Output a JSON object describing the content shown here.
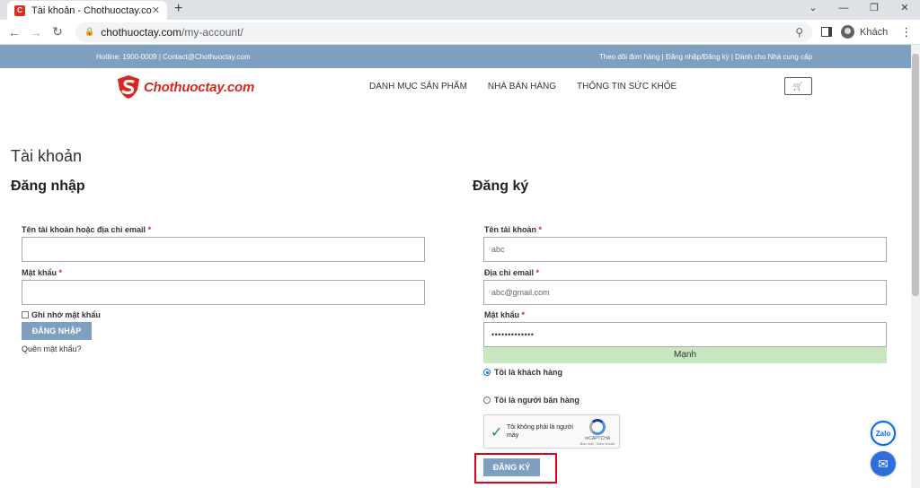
{
  "browser": {
    "tab_title": "Tài khoản - Chothuoctay.com",
    "tab_favicon": "C",
    "tab_close": "✕",
    "new_tab": "+",
    "url_host": "chothuoctay.com",
    "url_path": "/my-account/",
    "profile_label": "Khách",
    "win_controls": [
      "⌄",
      "—",
      "❐",
      "✕"
    ]
  },
  "topbar": {
    "left": "Hotline: 1900-0009 | Contact@Chothuoctay.com",
    "right": "Theo dõi đơn hàng | Đăng nhập/Đăng ký | Dành cho Nhà cung cấp"
  },
  "header": {
    "logo_text": "Chothuoctay.com",
    "nav": [
      "DANH MỤC SẢN PHẨM",
      "NHÀ BÁN HÀNG",
      "THÔNG TIN SỨC KHỎE"
    ],
    "cart_icon": "🛒"
  },
  "page": {
    "title": "Tài khoản"
  },
  "login": {
    "title": "Đăng nhập",
    "username_label": "Tên tài khoản hoặc địa chỉ email",
    "username_value": "",
    "password_label": "Mật khẩu",
    "password_value": "",
    "remember_label": "Ghi nhớ mật khẩu",
    "submit_label": "ĐĂNG NHẬP",
    "forgot_label": "Quên mật khẩu?"
  },
  "register": {
    "title": "Đăng ký",
    "username_label": "Tên tài khoản",
    "username_value": "abc",
    "email_label": "Địa chỉ email",
    "email_value": "abc@gmail.com",
    "password_label": "Mật khẩu",
    "password_value": "•••••••••••••",
    "strength_label": "Mạnh",
    "role_customer": "Tôi là khách hàng",
    "role_seller": "Tôi là người bán hàng",
    "submit_label": "ĐĂNG KÝ"
  },
  "captcha": {
    "text": "Tôi không phải là người máy",
    "brand": "reCAPTCHA",
    "privacy": "Bảo mật - Điều khoản"
  },
  "float": {
    "zalo": "Zalo",
    "messenger": "✉"
  },
  "colors": {
    "accent": "#7d9fc0",
    "brand_red": "#d7261f",
    "strength_green": "#c8e6c0",
    "highlight": "#e3001b"
  },
  "required_mark": "*"
}
